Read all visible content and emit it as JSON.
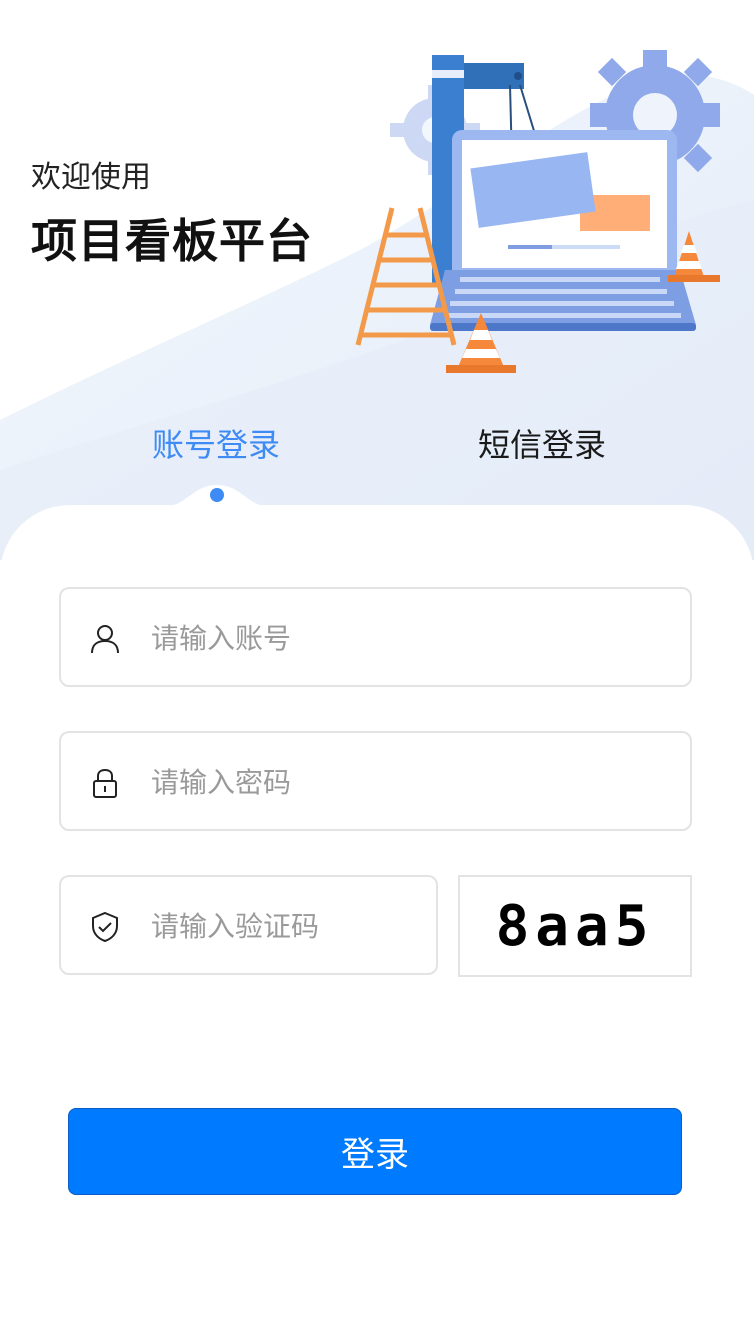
{
  "header": {
    "welcome": "欢迎使用",
    "title": "项目看板平台"
  },
  "tabs": {
    "account_label": "账号登录",
    "sms_label": "短信登录",
    "active": "account"
  },
  "form": {
    "account_placeholder": "请输入账号",
    "password_placeholder": "请输入密码",
    "captcha_placeholder": "请输入验证码",
    "captcha_text": "8aa5",
    "submit_label": "登录"
  },
  "icons": {
    "account": "user-icon",
    "password": "lock-icon",
    "captcha": "shield-check-icon"
  },
  "colors": {
    "accent": "#3e8bf5",
    "button": "#007bff"
  }
}
